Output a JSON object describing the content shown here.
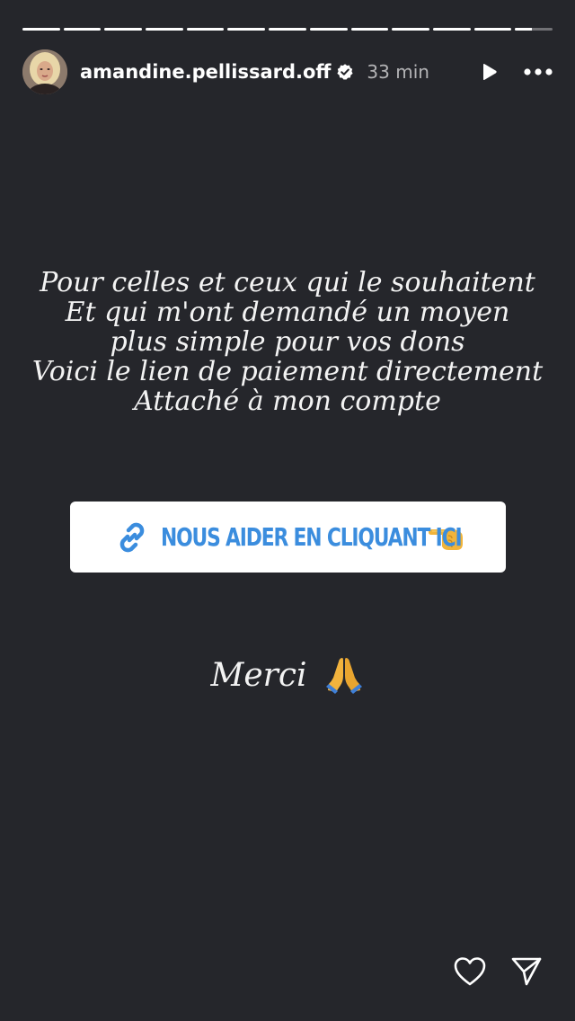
{
  "progress": {
    "segments": 13,
    "completed": 12,
    "current_fraction": 0.45
  },
  "header": {
    "username": "amandine.pellissard.off",
    "verified": true,
    "time": "33 min",
    "play_icon": "play-icon",
    "more_icon": "more-icon"
  },
  "story": {
    "lines": [
      "Pour celles et ceux qui le souhaitent",
      "Et qui m'ont demandé un moyen",
      "plus simple pour vos dons",
      "Voici le lien de paiement directement",
      "Attaché à mon compte"
    ],
    "link_sticker": {
      "label": "NOUS AIDER EN CLIQUANT ICI",
      "icon": "link-icon",
      "emoji": "backhand-index-pointing-left-icon",
      "color": "#3b8dde"
    },
    "closing": "Merci",
    "closing_emoji": "folded-hands-icon"
  },
  "footer": {
    "like_icon": "heart-icon",
    "share_icon": "send-icon"
  },
  "colors": {
    "background": "#25262b",
    "text": "#f3f3f3",
    "sticker_bg": "#ffffff"
  }
}
